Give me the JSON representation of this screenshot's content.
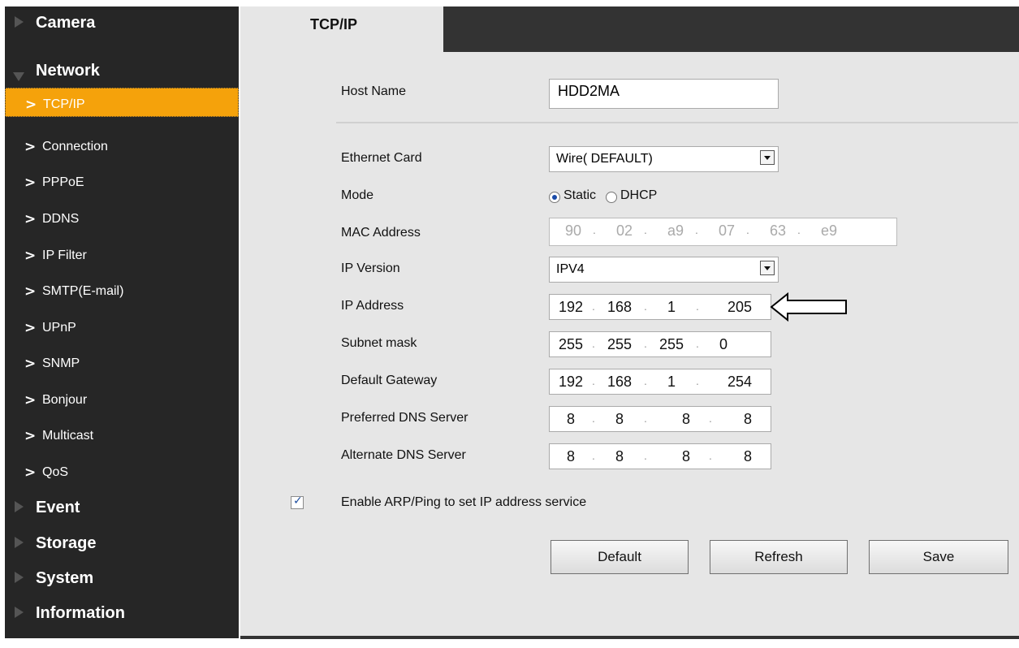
{
  "sidebar": {
    "camera": "Camera",
    "network": "Network",
    "network_items": [
      {
        "label": "TCP/IP"
      },
      {
        "label": "Connection"
      },
      {
        "label": "PPPoE"
      },
      {
        "label": "DDNS"
      },
      {
        "label": "IP Filter"
      },
      {
        "label": "SMTP(E-mail)"
      },
      {
        "label": "UPnP"
      },
      {
        "label": "SNMP"
      },
      {
        "label": "Bonjour"
      },
      {
        "label": "Multicast"
      },
      {
        "label": "QoS"
      }
    ],
    "event": "Event",
    "storage": "Storage",
    "system": "System",
    "information": "Information",
    "chevron": ">"
  },
  "tab": {
    "label": "TCP/IP"
  },
  "form": {
    "host_name_label": "Host Name",
    "host_name_value": "HDD2MA",
    "ethernet_card_label": "Ethernet Card",
    "ethernet_card_value": "Wire( DEFAULT)",
    "mode_label": "Mode",
    "mode_static": "Static",
    "mode_dhcp": "DHCP",
    "mac_label": "MAC Address",
    "mac": [
      "90",
      "02",
      "a9",
      "07",
      "63",
      "e9"
    ],
    "ip_version_label": "IP Version",
    "ip_version_value": "IPV4",
    "ip_address_label": "IP Address",
    "ip_address": [
      "192",
      "168",
      "1",
      "205"
    ],
    "subnet_label": "Subnet mask",
    "subnet": [
      "255",
      "255",
      "255",
      "0"
    ],
    "gateway_label": "Default Gateway",
    "gateway": [
      "192",
      "168",
      "1",
      "254"
    ],
    "dns1_label": "Preferred DNS Server",
    "dns1": [
      "8",
      "8",
      "8",
      "8"
    ],
    "dns2_label": "Alternate DNS Server",
    "dns2": [
      "8",
      "8",
      "8",
      "8"
    ],
    "arp_label": "Enable ARP/Ping to set IP address service",
    "arp_checked": true,
    "dot": "."
  },
  "buttons": {
    "default": "Default",
    "refresh": "Refresh",
    "save": "Save"
  }
}
